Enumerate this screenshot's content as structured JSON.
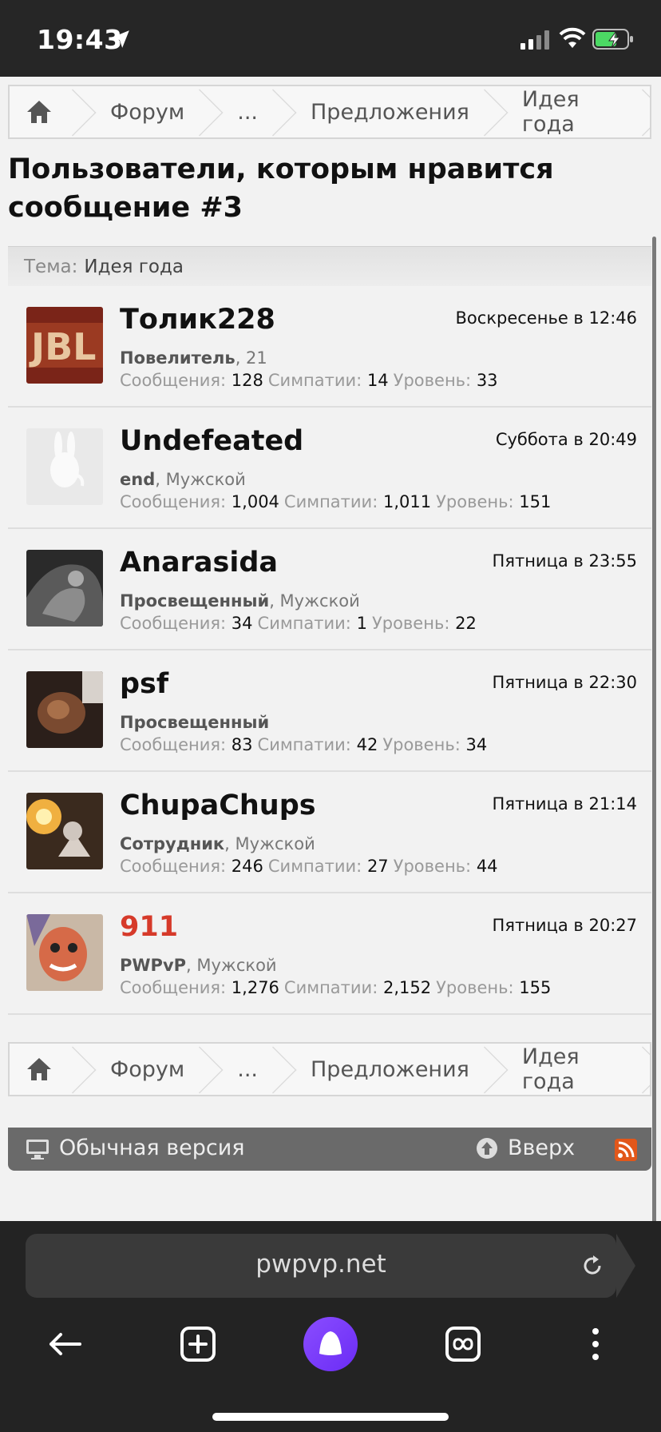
{
  "status_bar": {
    "time": "19:43"
  },
  "breadcrumbs": [
    "Форум",
    "...",
    "Предложения",
    "Идея года"
  ],
  "page_title": "Пользователи, которым нравится сообщение #3",
  "thread": {
    "label": "Тема:",
    "value": "Идея года"
  },
  "stats_labels": {
    "messages": "Сообщения:",
    "likes": "Симпатии:",
    "level": "Уровень:"
  },
  "users": [
    {
      "name": "Толик228",
      "role": "Повелитель",
      "extra": ", 21",
      "time": "Воскресенье в 12:46",
      "messages": "128",
      "likes": "14",
      "level": "33"
    },
    {
      "name": "Undefeated",
      "role": "end",
      "extra": ", Мужской",
      "time": "Суббота в 20:49",
      "messages": "1,004",
      "likes": "1,011",
      "level": "151"
    },
    {
      "name": "Anarasida",
      "role": "Просвещенный",
      "extra": ", Мужской",
      "time": "Пятница в 23:55",
      "messages": "34",
      "likes": "1",
      "level": "22"
    },
    {
      "name": "psf",
      "role": "Просвещенный",
      "extra": "",
      "time": "Пятница в 22:30",
      "messages": "83",
      "likes": "42",
      "level": "34"
    },
    {
      "name": "ChupaChups",
      "role": "Сотрудник",
      "extra": ", Мужской",
      "time": "Пятница в 21:14",
      "messages": "246",
      "likes": "27",
      "level": "44"
    },
    {
      "name": "911",
      "role": "PWPvP",
      "extra": ", Мужской",
      "time": "Пятница в 20:27",
      "messages": "1,276",
      "likes": "2,152",
      "level": "155"
    }
  ],
  "footer": {
    "desktop_label": "Обычная версия",
    "top_label": "Вверх"
  },
  "browser": {
    "url": "pwpvp.net"
  },
  "colors": {
    "accent_red": "#d63a2a",
    "footer_bg": "#6a6a6a",
    "alice_purple": "#7a3cff"
  }
}
